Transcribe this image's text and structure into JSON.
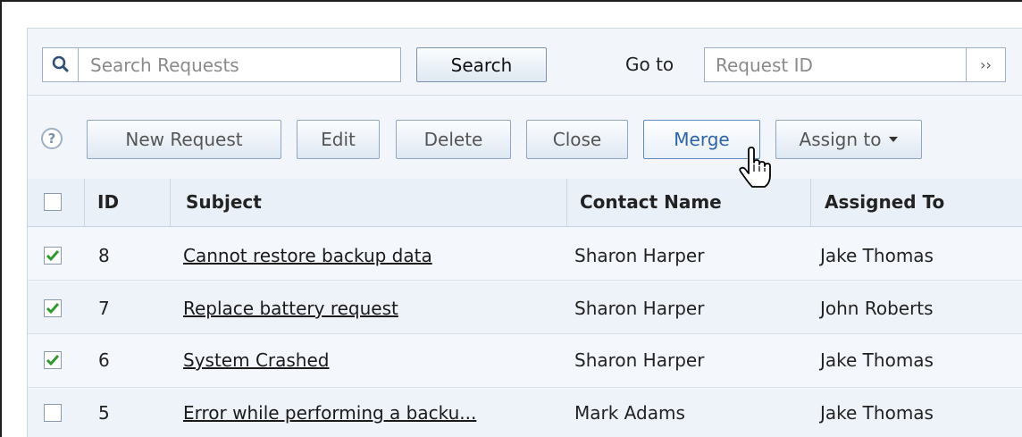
{
  "search": {
    "placeholder": "Search Requests",
    "button_label": "Search",
    "goto_label": "Go to",
    "goto_placeholder": "Request ID",
    "goto_arrow": "››"
  },
  "toolbar": {
    "help": "?",
    "new_request": "New Request",
    "edit": "Edit",
    "delete": "Delete",
    "close": "Close",
    "merge": "Merge",
    "assign_to": "Assign to"
  },
  "table": {
    "headers": {
      "id": "ID",
      "subject": "Subject",
      "contact": "Contact Name",
      "assigned": "Assigned To"
    },
    "rows": [
      {
        "checked": true,
        "id": "8",
        "subject": "Cannot restore backup data",
        "contact": "Sharon Harper",
        "assigned": "Jake Thomas"
      },
      {
        "checked": true,
        "id": "7",
        "subject": "Replace battery request",
        "contact": "Sharon Harper",
        "assigned": "John Roberts"
      },
      {
        "checked": true,
        "id": "6",
        "subject": "System Crashed",
        "contact": "Sharon Harper",
        "assigned": "Jake Thomas"
      },
      {
        "checked": false,
        "id": "5",
        "subject": "Error while performing a backu...",
        "contact": "Mark Adams",
        "assigned": "Jake Thomas"
      }
    ]
  },
  "colors": {
    "accent": "#2d63a8",
    "check": "#2e9a2e"
  }
}
